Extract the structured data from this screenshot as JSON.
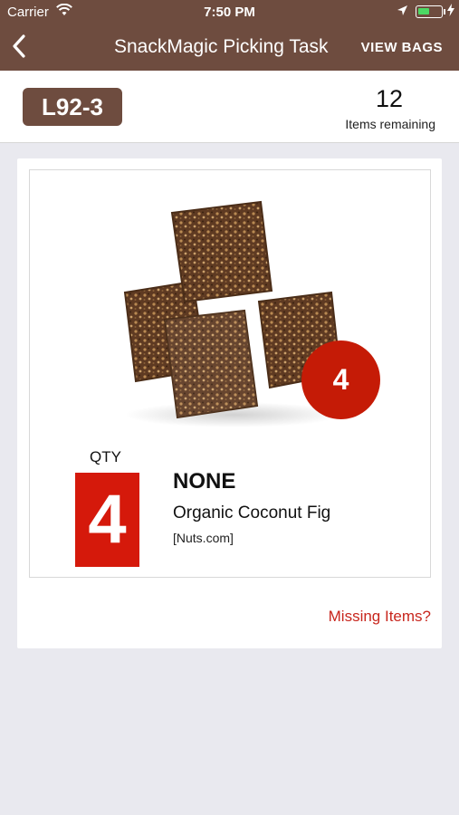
{
  "status_bar": {
    "carrier": "Carrier",
    "time": "7:50 PM",
    "battery_level": 0.5,
    "battery_color": "#4cd964"
  },
  "nav": {
    "title": "SnackMagic Picking Task",
    "back_icon": "chevron-left-icon",
    "view_bags_label": "VIEW BAGS",
    "background_color": "#6e4c3f"
  },
  "summary": {
    "location_code": "L92-3",
    "items_remaining_count": "12",
    "items_remaining_label": "Items remaining"
  },
  "item": {
    "badge_quantity": "4",
    "qty_label": "QTY",
    "quantity": "4",
    "variant": "NONE",
    "name": "Organic Coconut Fig",
    "brand": "[Nuts.com]",
    "accent_color": "#d5190b"
  },
  "footer": {
    "missing_items_label": "Missing Items?"
  }
}
